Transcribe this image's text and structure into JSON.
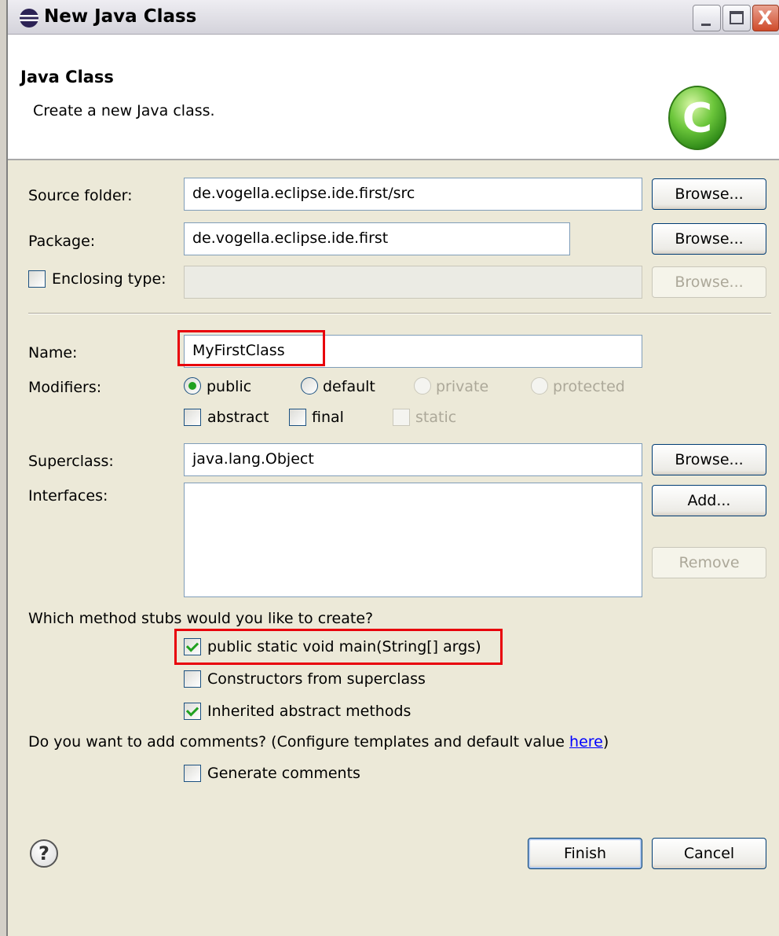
{
  "window": {
    "title": "New Java Class",
    "minimize_icon": "minimize-icon",
    "maximize_icon": "maximize-icon",
    "close_icon": "close-icon",
    "close_glyph": "X"
  },
  "header": {
    "title": "Java Class",
    "subtitle": "Create a new Java class.",
    "logo_icon": "java-class-c-icon",
    "logo_letter": "C"
  },
  "form": {
    "source_folder": {
      "label": "Source folder:",
      "value": "de.vogella.eclipse.ide.first/src",
      "button": "Browse..."
    },
    "package": {
      "label": "Package:",
      "value": "de.vogella.eclipse.ide.first",
      "button": "Browse..."
    },
    "enclosing_type": {
      "label": "Enclosing type:",
      "checked": false,
      "value": "",
      "button": "Browse..."
    },
    "name": {
      "label": "Name:",
      "value": "MyFirstClass"
    },
    "modifiers": {
      "label": "Modifiers:",
      "options": [
        "public",
        "default",
        "private",
        "protected"
      ],
      "selected": "public",
      "checks": [
        {
          "label": "abstract",
          "checked": false
        },
        {
          "label": "final",
          "checked": false
        },
        {
          "label": "static",
          "checked": false
        }
      ]
    },
    "superclass": {
      "label": "Superclass:",
      "value": "java.lang.Object",
      "button": "Browse..."
    },
    "interfaces": {
      "label": "Interfaces:",
      "add_button": "Add...",
      "remove_button": "Remove"
    },
    "stubs": {
      "question": "Which method stubs would you like to create?",
      "items": [
        {
          "label": "public static void main(String[] args)",
          "checked": true
        },
        {
          "label": "Constructors from superclass",
          "checked": false
        },
        {
          "label": "Inherited abstract methods",
          "checked": true
        }
      ]
    },
    "comments": {
      "question_prefix": "Do you want to add comments? (Configure templates and default value ",
      "link": "here",
      "question_suffix": ")",
      "generate_label": "Generate comments",
      "checked": false
    }
  },
  "footer": {
    "help_icon": "help-icon",
    "help_glyph": "?",
    "finish": "Finish",
    "cancel": "Cancel"
  },
  "colors": {
    "highlight": "#e8000b",
    "check_green": "#21a121",
    "link_blue": "#0000ff"
  }
}
